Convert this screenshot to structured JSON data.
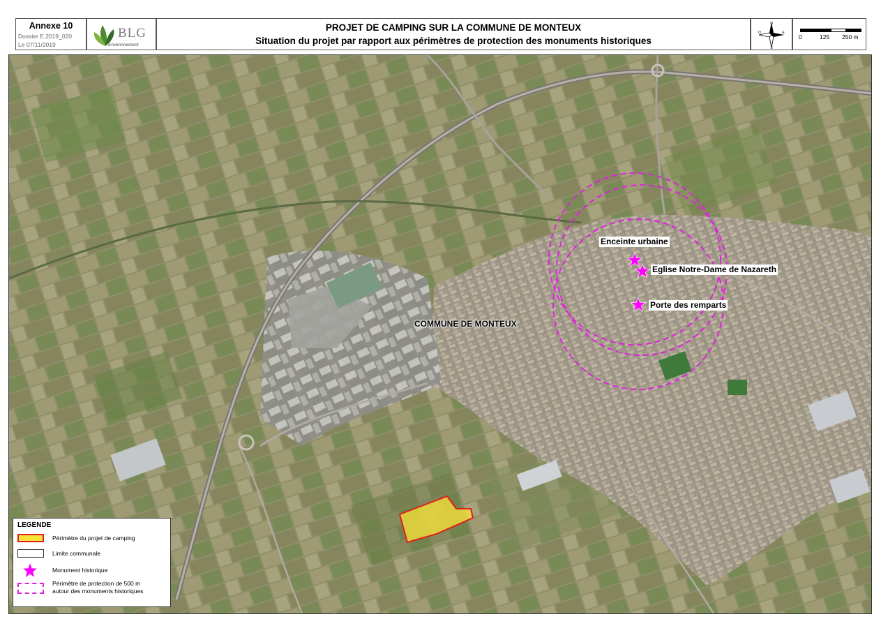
{
  "header": {
    "annexe": "Annexe 10",
    "dossier": "Dossier E.2019_020",
    "date": "Le 07/11/2019",
    "logo_text": "BLG",
    "logo_sub": "Environnement",
    "title_line1": "PROJET DE CAMPING SUR LA COMMUNE DE MONTEUX",
    "title_line2": "Situation du projet par rapport aux périmètres de protection des monuments historiques",
    "compass_icon": "compass-rose-icon",
    "scale": {
      "labels": [
        "0",
        "125",
        "250 m"
      ]
    }
  },
  "map": {
    "labels": {
      "enceinte": "Enceinte urbaine",
      "eglise": "Eglise Notre-Dame de Nazareth",
      "porte": "Porte des remparts",
      "commune": "COMMUNE DE MONTEUX"
    }
  },
  "legend": {
    "title": "LEGENDE",
    "items": [
      {
        "label": "Périmètre du projet de camping"
      },
      {
        "label": "Limite communale"
      },
      {
        "label": "Monument historique"
      },
      {
        "label_line1": "Périmètre de protection de 500 m",
        "label_line2": "autour des monuments historiques"
      }
    ]
  },
  "colors": {
    "project_fill": "#f5e23a",
    "project_border": "#e0201c",
    "monument": "#ff00ff",
    "protection": "#e020e0",
    "communal_limit": "#333333"
  }
}
